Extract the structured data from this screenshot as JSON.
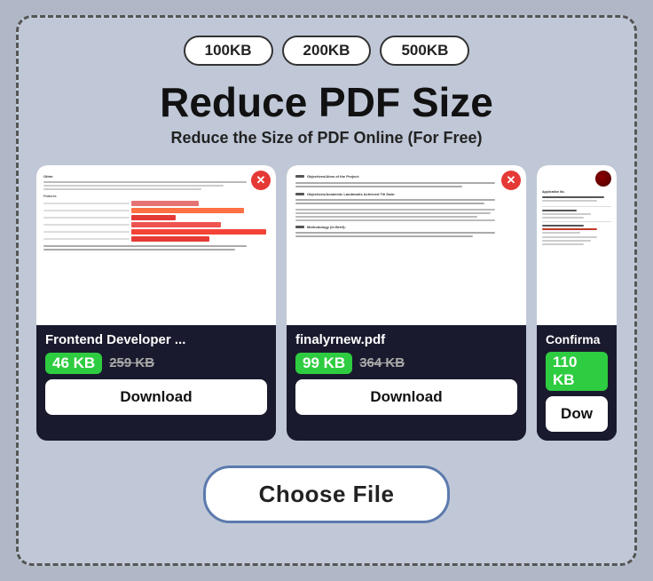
{
  "app": {
    "title": "Reduce PDF Size",
    "subtitle": "Reduce the Size of PDF Online (For Free)"
  },
  "size_badges": [
    "100KB",
    "200KB",
    "500KB"
  ],
  "cards": [
    {
      "filename": "Frontend Developer ...",
      "size_new": "46 KB",
      "size_old": "259 KB",
      "download_label": "Download"
    },
    {
      "filename": "finalyrnew.pdf",
      "size_new": "99 KB",
      "size_old": "364 KB",
      "download_label": "Download"
    },
    {
      "filename": "Confirma",
      "size_new": "110 KB",
      "size_old": "",
      "download_label": "Dow"
    }
  ],
  "choose_file_label": "Choose File",
  "close_icon_label": "✕"
}
